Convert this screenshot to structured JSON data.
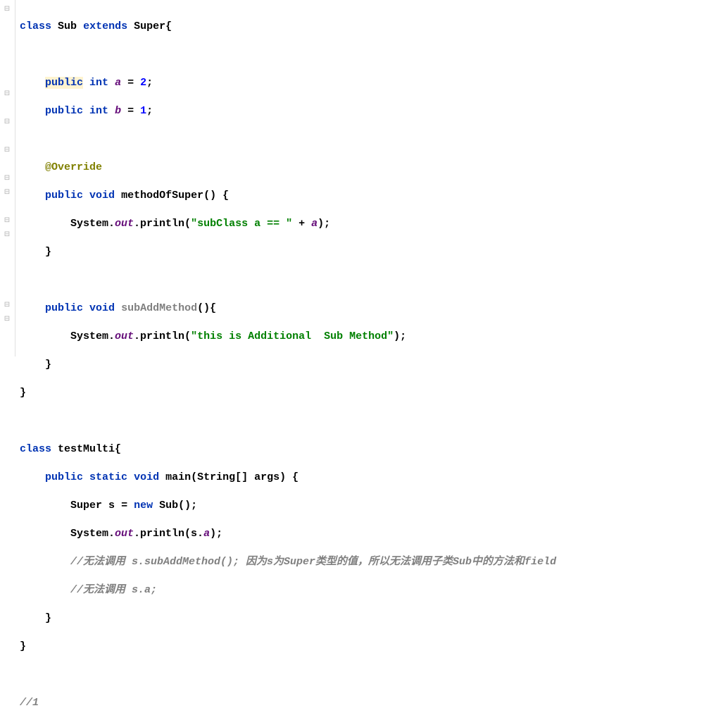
{
  "code": {
    "l1": {
      "kw_class": "class",
      "name": "Sub",
      "kw_extends": "extends",
      "super": "Super",
      "brace": "{"
    },
    "l3": {
      "kw_public": "public",
      "kw_int": "int",
      "field": "a",
      "eq": "=",
      "val": "2",
      "semi": ";"
    },
    "l4": {
      "kw_public": "public",
      "kw_int": "int",
      "field": "b",
      "eq": "=",
      "val": "1",
      "semi": ";"
    },
    "l6": {
      "anno": "@Override"
    },
    "l7": {
      "kw_public": "public",
      "kw_void": "void",
      "method": "methodOfSuper",
      "parens": "() {"
    },
    "l8": {
      "sys": "System.",
      "out": "out",
      "dot": ".println(",
      "str": "\"subClass a == \"",
      "plus": " + ",
      "field": "a",
      "end": ");"
    },
    "l9": {
      "brace": "}"
    },
    "l11": {
      "kw_public": "public",
      "kw_void": "void",
      "method": "subAddMethod",
      "parens": "(){"
    },
    "l12": {
      "sys": "System.",
      "out": "out",
      "dot": ".println(",
      "str": "\"this is Additional  Sub Method\"",
      "end": ");"
    },
    "l13": {
      "brace": "}"
    },
    "l14": {
      "brace": "}"
    },
    "l16": {
      "kw_class": "class",
      "name": "testMulti",
      "brace": "{"
    },
    "l17": {
      "kw_public": "public",
      "kw_static": "static",
      "kw_void": "void",
      "method": "main",
      "params": "(String[] args) {"
    },
    "l18": {
      "type": "Super",
      "var": "s",
      "eq": " = ",
      "kw_new": "new",
      "ctor": " Sub();"
    },
    "l19": {
      "sys": "System.",
      "out": "out",
      "dot": ".println(s.",
      "field": "a",
      "end": ");"
    },
    "l20": {
      "comment": "//无法调用 s.subAddMethod(); 因为s为Super类型的值，所以无法调用子类Sub中的方法和field"
    },
    "l21": {
      "comment": "//无法调用 s.a;"
    },
    "l22": {
      "brace": "}"
    },
    "l23": {
      "brace": "}"
    },
    "l25": {
      "comment": "//1"
    }
  }
}
